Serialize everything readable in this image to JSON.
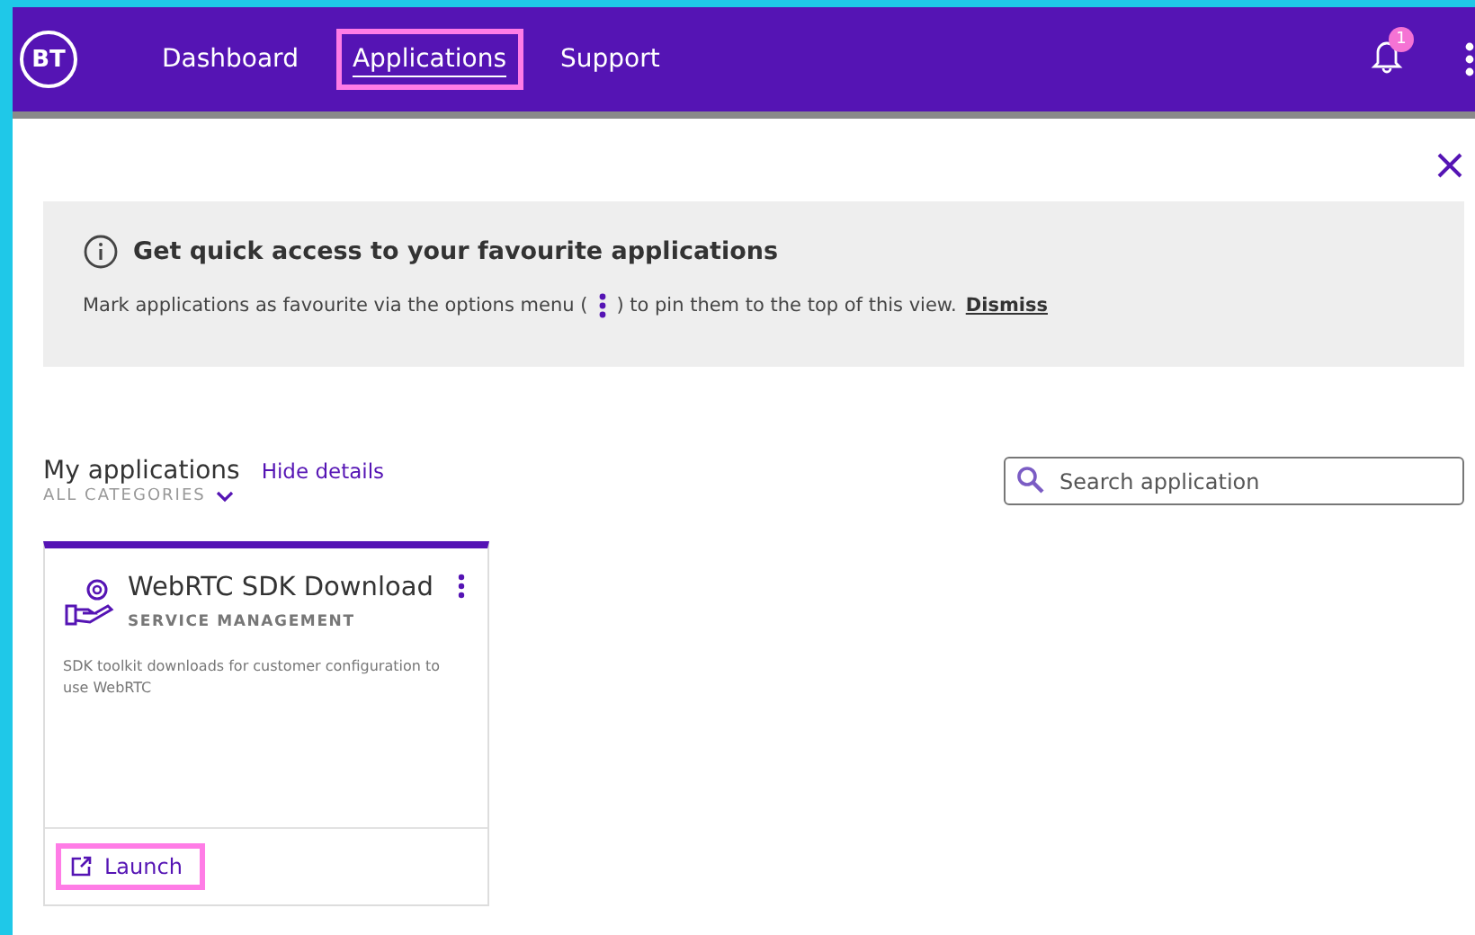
{
  "header": {
    "logo": "BT",
    "nav": [
      {
        "label": "Dashboard",
        "selected": false,
        "highlighted": false
      },
      {
        "label": "Applications",
        "selected": true,
        "highlighted": true
      },
      {
        "label": "Support",
        "selected": false,
        "highlighted": false
      }
    ],
    "notification_count": "1"
  },
  "banner": {
    "title": "Get quick access to your favourite applications",
    "text_before": "Mark applications as favourite via the options menu (",
    "text_after": ") to pin them to the top of this view.",
    "dismiss": "Dismiss"
  },
  "section": {
    "title": "My applications",
    "toggle": "Hide details",
    "filter": "ALL CATEGORIES"
  },
  "search": {
    "placeholder": "Search application"
  },
  "apps": [
    {
      "name": "WebRTC SDK Download",
      "category": "SERVICE MANAGEMENT",
      "description": "SDK toolkit downloads for customer configuration to use WebRTC",
      "action": "Launch",
      "highlighted": true
    }
  ]
}
